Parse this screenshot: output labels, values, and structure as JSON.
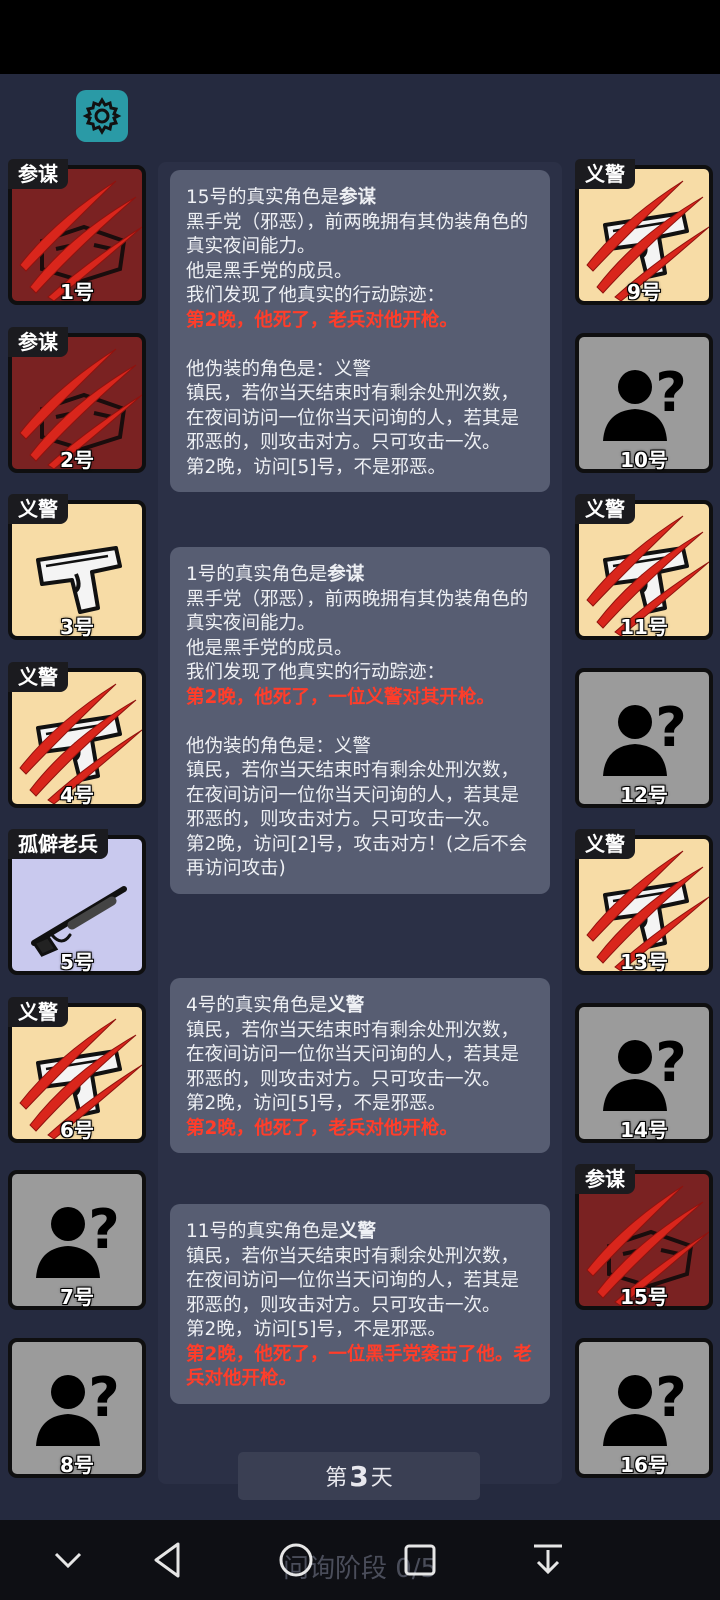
{
  "settings_icon": "gear-icon",
  "players": [
    {
      "num": "1号",
      "role": "参谋",
      "side": "left",
      "bg": "#7a2222",
      "art": "mask",
      "dead": true
    },
    {
      "num": "2号",
      "role": "参谋",
      "side": "left",
      "bg": "#7a2222",
      "art": "mask",
      "dead": true
    },
    {
      "num": "3号",
      "role": "义警",
      "side": "left",
      "bg": "#f7dca6",
      "art": "pistol",
      "dead": false
    },
    {
      "num": "4号",
      "role": "义警",
      "side": "left",
      "bg": "#f7dca6",
      "art": "pistol",
      "dead": true
    },
    {
      "num": "5号",
      "role": "孤僻老兵",
      "side": "left",
      "bg": "#c9c9ee",
      "art": "rifle",
      "dead": false
    },
    {
      "num": "6号",
      "role": "义警",
      "side": "left",
      "bg": "#f7dca6",
      "art": "pistol",
      "dead": true
    },
    {
      "num": "7号",
      "role": "",
      "side": "left",
      "bg": "#9b9b9b",
      "art": "unknown",
      "dead": false
    },
    {
      "num": "8号",
      "role": "",
      "side": "left",
      "bg": "#9b9b9b",
      "art": "unknown",
      "dead": false
    },
    {
      "num": "9号",
      "role": "义警",
      "side": "right",
      "bg": "#f7dca6",
      "art": "pistol",
      "dead": true
    },
    {
      "num": "10号",
      "role": "",
      "side": "right",
      "bg": "#9b9b9b",
      "art": "unknown",
      "dead": false
    },
    {
      "num": "11号",
      "role": "义警",
      "side": "right",
      "bg": "#f7dca6",
      "art": "pistol",
      "dead": true
    },
    {
      "num": "12号",
      "role": "",
      "side": "right",
      "bg": "#9b9b9b",
      "art": "unknown",
      "dead": false
    },
    {
      "num": "13号",
      "role": "义警",
      "side": "right",
      "bg": "#f7dca6",
      "art": "pistol",
      "dead": true
    },
    {
      "num": "14号",
      "role": "",
      "side": "right",
      "bg": "#9b9b9b",
      "art": "unknown",
      "dead": false
    },
    {
      "num": "15号",
      "role": "参谋",
      "side": "right",
      "bg": "#7a2222",
      "art": "mask",
      "dead": true
    },
    {
      "num": "16号",
      "role": "",
      "side": "right",
      "bg": "#9b9b9b",
      "art": "unknown",
      "dead": false
    }
  ],
  "logs": [
    {
      "title_prefix": "15号的真实角色是",
      "title_role": "参谋",
      "paragraphs": [
        {
          "text": "黑手党（邪恶），前两晚拥有其伪装角色的真实夜间能力。",
          "red": false
        },
        {
          "text": "他是黑手党的成员。",
          "red": false
        },
        {
          "text": "我们发现了他真实的行动踪迹：",
          "red": false
        },
        {
          "text": "第2晚，他死了，老兵对他开枪。",
          "red": true
        },
        {
          "text": "",
          "red": false
        },
        {
          "text": "他伪装的角色是：义警",
          "red": false
        },
        {
          "text": "镇民，若你当天结束时有剩余处刑次数，在夜间访问一位你当天问询的人，若其是邪恶的，则攻击对方。只可攻击一次。",
          "red": false
        },
        {
          "text": "第2晚，访问[5]号，不是邪恶。",
          "red": false
        }
      ]
    },
    {
      "title_prefix": "1号的真实角色是",
      "title_role": "参谋",
      "paragraphs": [
        {
          "text": "黑手党（邪恶），前两晚拥有其伪装角色的真实夜间能力。",
          "red": false
        },
        {
          "text": "他是黑手党的成员。",
          "red": false
        },
        {
          "text": "我们发现了他真实的行动踪迹：",
          "red": false
        },
        {
          "text": "第2晚，他死了，一位义警对其开枪。",
          "red": true
        },
        {
          "text": "",
          "red": false
        },
        {
          "text": "他伪装的角色是：义警",
          "red": false
        },
        {
          "text": "镇民，若你当天结束时有剩余处刑次数，在夜间访问一位你当天问询的人，若其是邪恶的，则攻击对方。只可攻击一次。",
          "red": false
        },
        {
          "text": "第2晚，访问[2]号，攻击对方！(之后不会再访问攻击)",
          "red": false
        }
      ]
    },
    {
      "title_prefix": "4号的真实角色是",
      "title_role": "义警",
      "paragraphs": [
        {
          "text": "镇民，若你当天结束时有剩余处刑次数，在夜间访问一位你当天问询的人，若其是邪恶的，则攻击对方。只可攻击一次。",
          "red": false
        },
        {
          "text": "第2晚，访问[5]号，不是邪恶。",
          "red": false
        },
        {
          "text": "第2晚，他死了，老兵对他开枪。",
          "red": true
        }
      ]
    },
    {
      "title_prefix": "11号的真实角色是",
      "title_role": "义警",
      "paragraphs": [
        {
          "text": "镇民，若你当天结束时有剩余处刑次数，在夜间访问一位你当天问询的人，若其是邪恶的，则攻击对方。只可攻击一次。",
          "red": false
        },
        {
          "text": "第2晚，访问[5]号，不是邪恶。",
          "red": false
        },
        {
          "text": "第2晚，他死了，一位黑手党袭击了他。老兵对他开枪。",
          "red": true
        }
      ]
    }
  ],
  "day": {
    "prefix": "第",
    "number": "3",
    "suffix": "天"
  },
  "phase_label": "问询阶段 0/5",
  "nav_icons": [
    "chevron-down-icon",
    "back-icon",
    "home-icon",
    "recents-icon",
    "collapse-icon"
  ],
  "colors": {
    "background": "#252a3f",
    "panel": "#2b3046",
    "log_card": "#575d72",
    "highlight_red": "#ff3d2a",
    "accent": "#2a9aa6"
  }
}
